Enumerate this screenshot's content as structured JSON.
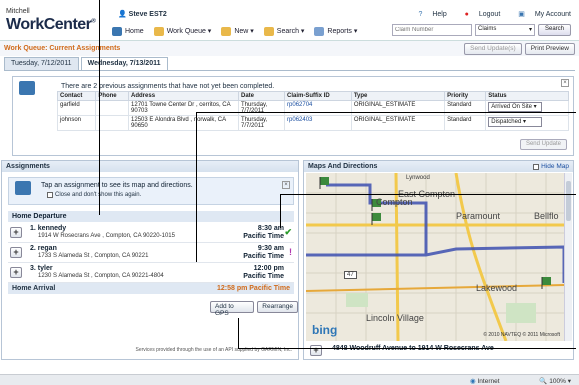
{
  "header": {
    "logo_small": "Mitchell",
    "logo_big": "WorkCenter",
    "user": "Steve EST2",
    "links": {
      "help": "Help",
      "logout": "Logout",
      "account": "My Account"
    },
    "nav": [
      "Home",
      "Work Queue ▾",
      "New ▾",
      "Search ▾",
      "Reports ▾"
    ],
    "search": {
      "placeholder": "Claim Number",
      "scope": "Claims",
      "button": "Search"
    }
  },
  "workqueue": {
    "title": "Work Queue: Current Assignments",
    "buttons": {
      "send_updates": "Send Update(s)",
      "print_preview": "Print Preview"
    },
    "tabs": [
      "Tuesday, 7/12/2011",
      "Wednesday, 7/13/2011"
    ]
  },
  "previous": {
    "message": "There are 2 previous assignments that have not yet been completed.",
    "columns": [
      "Contact",
      "Phone",
      "Address",
      "Date",
      "Claim-Suffix ID",
      "Type",
      "Priority",
      "Status"
    ],
    "rows": [
      {
        "contact": "garfield",
        "phone": "",
        "address": "12701 Towne Center Dr , cerritos, CA 90703",
        "date": "Thursday, 7/7/2011",
        "claim": "rp062704",
        "type": "ORIGINAL_ESTIMATE",
        "priority": "Standard",
        "status": "Arrived On Site"
      },
      {
        "contact": "johnson",
        "phone": "",
        "address": "12503 E Alondra Blvd , norwalk, CA 90650",
        "date": "Thursday, 7/7/2011",
        "claim": "rp062403",
        "type": "ORIGINAL_ESTIMATE",
        "priority": "Standard",
        "status": "Dispatched"
      }
    ],
    "send_update": "Send Update"
  },
  "assignments": {
    "title": "Assignments",
    "tip": "Tap an assignment to see its map and directions.",
    "tip_check": "Close and don't show this again.",
    "departure": "Home Departure",
    "stops": [
      {
        "name": "1. kennedy",
        "address": "1914 W Rosecrans Ave , Compton, CA 90220-1015",
        "time": "8:30 am",
        "tz": "Pacific Time",
        "flag": "✔",
        "flag_color": "#2a9a2a"
      },
      {
        "name": "2. regan",
        "address": "1733 S Alameda St , Compton, CA 90221",
        "time": "9:30 am",
        "tz": "Pacific Time",
        "flag": "!",
        "flag_color": "#b03ab0"
      },
      {
        "name": "3. tyler",
        "address": "1230 S Alameda St , Compton, CA 90221-4804",
        "time": "12:00 pm",
        "tz": "Pacific Time",
        "flag": "",
        "flag_color": "#000000"
      }
    ],
    "arrival": "Home Arrival",
    "arrival_time": "12:58 pm Pacific Time",
    "btn_gps": "Add to GPS",
    "btn_rearrange": "Rearrange",
    "garmin": "Services provided through the use of an API supplied by GARMIN, Inc."
  },
  "map": {
    "title": "Maps And Directions",
    "hide": "Hide Map",
    "labels": [
      "Compton",
      "East Compton",
      "Paramount",
      "Bellflo",
      "Lakewood",
      "Lincoln Village",
      "Lynwood",
      "47"
    ],
    "bing": "bing",
    "copyright": "© 2010 NAVTEQ © 2011 Microsoft",
    "direction": "4848 Woodruff Avenue to 1914 W Rosecrans Ave"
  },
  "statusbar": {
    "internet": "Internet",
    "zoom": "100%"
  }
}
